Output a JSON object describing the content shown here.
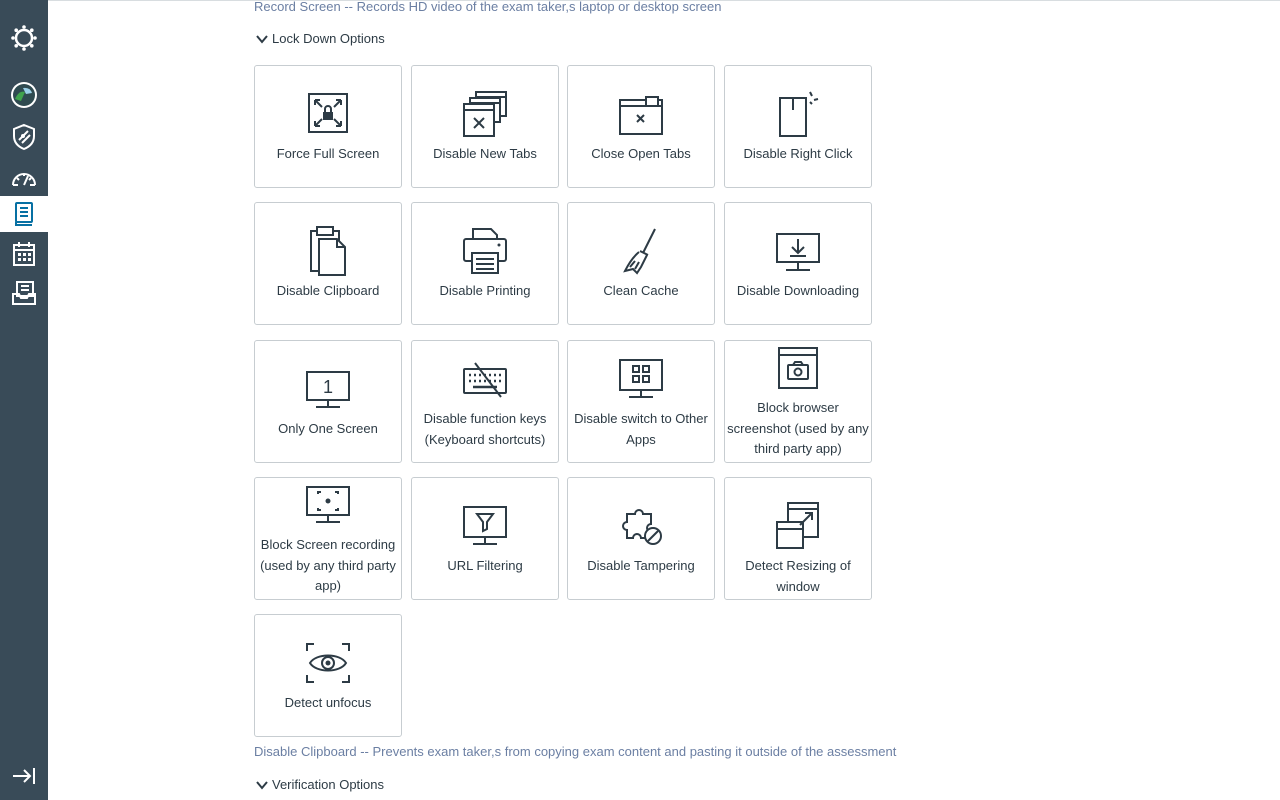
{
  "colors": {
    "sidebar_bg": "#394b58",
    "active_icon": "#0770a3",
    "note_text": "#6b7fa3",
    "tile_border": "#c7cdd1",
    "text": "#2d3b45"
  },
  "sidebar": {
    "items": [
      {
        "name": "logo",
        "icon": "canvas-logo-icon"
      },
      {
        "name": "account",
        "icon": "account-avatar-icon"
      },
      {
        "name": "admin",
        "icon": "shield-icon"
      },
      {
        "name": "dashboard",
        "icon": "speedometer-icon"
      },
      {
        "name": "courses",
        "icon": "book-icon",
        "active": true
      },
      {
        "name": "calendar",
        "icon": "calendar-icon"
      },
      {
        "name": "inbox",
        "icon": "inbox-icon"
      }
    ],
    "collapse_icon": "collapse-arrow-icon"
  },
  "record_screen_note": "Record Screen -- Records HD video of the exam taker,s laptop or desktop screen",
  "lockdown": {
    "title": "Lock Down Options",
    "options": [
      {
        "label": "Force Full Screen",
        "icon": "fullscreen-lock-icon"
      },
      {
        "label": "Disable New Tabs",
        "icon": "new-tabs-blocked-icon"
      },
      {
        "label": "Close Open Tabs",
        "icon": "close-tab-icon"
      },
      {
        "label": "Disable Right Click",
        "icon": "right-click-icon"
      },
      {
        "label": "Disable Clipboard",
        "icon": "clipboard-icon"
      },
      {
        "label": "Disable Printing",
        "icon": "printer-icon"
      },
      {
        "label": "Clean Cache",
        "icon": "broom-icon"
      },
      {
        "label": "Disable Downloading",
        "icon": "download-monitor-icon"
      },
      {
        "label": "Only One Screen",
        "icon": "single-monitor-icon"
      },
      {
        "label": "Disable function keys (Keyboard shortcuts)",
        "icon": "keyboard-blocked-icon"
      },
      {
        "label": "Disable switch to Other Apps",
        "icon": "app-grid-monitor-icon"
      },
      {
        "label": "Block browser screenshot (used by any third party app)",
        "icon": "browser-camera-icon"
      },
      {
        "label": "Block Screen recording (used by any third party app)",
        "icon": "screen-record-icon"
      },
      {
        "label": "URL Filtering",
        "icon": "filter-monitor-icon"
      },
      {
        "label": "Disable Tampering",
        "icon": "puzzle-blocked-icon"
      },
      {
        "label": "Detect Resizing of window",
        "icon": "window-resize-icon"
      },
      {
        "label": "Detect unfocus",
        "icon": "eye-focus-icon"
      }
    ]
  },
  "clipboard_note": "Disable Clipboard -- Prevents exam taker,s from copying exam content and pasting it outside of the assessment",
  "verification": {
    "title": "Verification Options"
  }
}
